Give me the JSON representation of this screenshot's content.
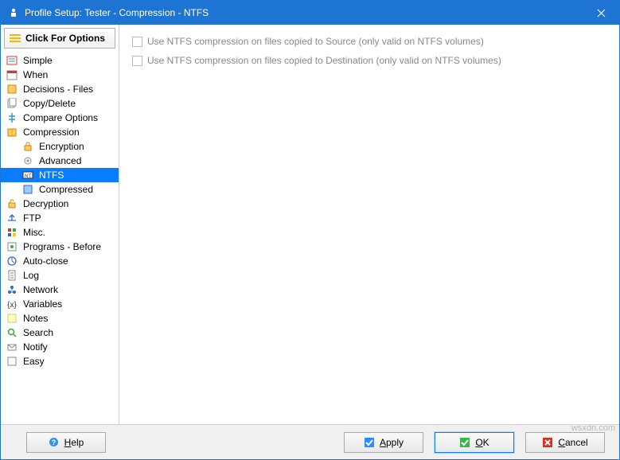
{
  "window": {
    "title": "Profile Setup: Tester - Compression - NTFS"
  },
  "sidebar": {
    "options_label": "Click For Options",
    "items": [
      {
        "label": "Simple",
        "icon": "checklist"
      },
      {
        "label": "When",
        "icon": "calendar"
      },
      {
        "label": "Decisions - Files",
        "icon": "decision"
      },
      {
        "label": "Copy/Delete",
        "icon": "copy"
      },
      {
        "label": "Compare Options",
        "icon": "compare"
      },
      {
        "label": "Compression",
        "icon": "compress"
      },
      {
        "label": "Encryption",
        "icon": "encrypt",
        "indent": true
      },
      {
        "label": "Advanced",
        "icon": "advanced",
        "indent": true
      },
      {
        "label": "NTFS",
        "icon": "ntfs",
        "indent": true,
        "selected": true
      },
      {
        "label": "Compressed",
        "icon": "compressed",
        "indent": true
      },
      {
        "label": "Decryption",
        "icon": "decrypt"
      },
      {
        "label": "FTP",
        "icon": "ftp"
      },
      {
        "label": "Misc.",
        "icon": "misc"
      },
      {
        "label": "Programs - Before",
        "icon": "programs"
      },
      {
        "label": "Auto-close",
        "icon": "autoclose"
      },
      {
        "label": "Log",
        "icon": "log"
      },
      {
        "label": "Network",
        "icon": "network"
      },
      {
        "label": "Variables",
        "icon": "variables"
      },
      {
        "label": "Notes",
        "icon": "notes"
      },
      {
        "label": "Search",
        "icon": "search"
      },
      {
        "label": "Notify",
        "icon": "notify"
      },
      {
        "label": "Easy",
        "icon": "easy"
      }
    ]
  },
  "content": {
    "chk_source": "Use NTFS compression on files copied to Source (only valid on NTFS volumes)",
    "chk_destination": "Use NTFS compression on files copied to Destination (only valid on NTFS volumes)"
  },
  "buttons": {
    "help": "Help",
    "apply": "Apply",
    "ok": "OK",
    "cancel": "Cancel"
  },
  "watermark": "wsxdn.com"
}
